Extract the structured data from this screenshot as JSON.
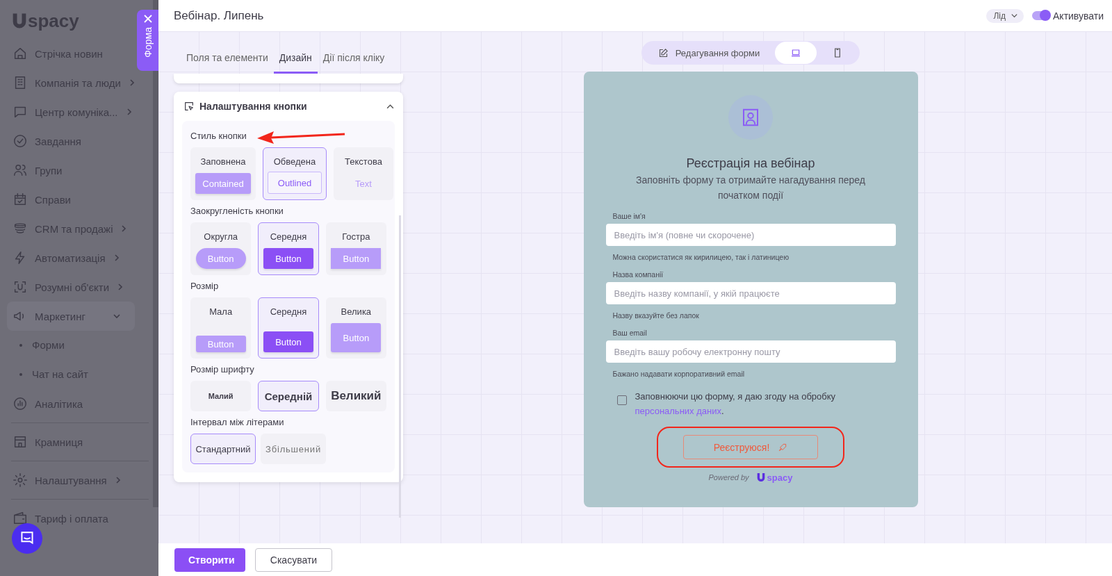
{
  "sidebar": {
    "logo": "spacy",
    "sections": [
      [
        {
          "label": "Стрічка новин"
        },
        {
          "label": "Компанія та люди",
          "expanded": false
        },
        {
          "label": "Центр комуніка...",
          "expanded": false
        },
        {
          "label": "Завдання"
        },
        {
          "label": "Групи"
        },
        {
          "label": "Справи"
        },
        {
          "label": "CRM та продажі",
          "expanded": false
        },
        {
          "label": "Автоматизація",
          "expanded": false
        },
        {
          "label": "Розумні об'єкти",
          "expanded": false
        },
        {
          "label": "Маркетинг",
          "expanded": true,
          "children": [
            {
              "label": "Форми"
            },
            {
              "label": "Чат на сайт"
            }
          ]
        },
        {
          "label": "Аналітика"
        }
      ],
      [
        {
          "label": "Крамниця"
        }
      ],
      [
        {
          "label": "Налаштування",
          "expanded": false
        }
      ],
      [
        {
          "label": "Тариф і оплата"
        }
      ]
    ]
  },
  "side_tab": {
    "label": "Форма"
  },
  "header": {
    "title": "Вебінар. Липень",
    "type_select": "Лід",
    "activate": {
      "label": "Активувати",
      "on": true
    }
  },
  "editor": {
    "tabs": [
      {
        "label": "Поля та елементи",
        "selected": false
      },
      {
        "label": "Дизайн",
        "selected": true
      },
      {
        "label": "Дії після кліку",
        "selected": false
      }
    ],
    "section": {
      "title": "Налаштування кнопки",
      "expanded": true,
      "groups": [
        {
          "label": "Стиль кнопки",
          "kind": "style",
          "options": [
            {
              "label": "Заповнена",
              "preview": "Contained",
              "kind": "contained",
              "selected": false
            },
            {
              "label": "Обведена",
              "preview": "Outlined",
              "kind": "outlined",
              "selected": true
            },
            {
              "label": "Текстова",
              "preview": "Text",
              "kind": "text",
              "selected": false
            }
          ]
        },
        {
          "label": "Заокругленість кнопки",
          "kind": "shape",
          "options": [
            {
              "label": "Округла",
              "preview": "Button",
              "kind": "round",
              "selected": false
            },
            {
              "label": "Середня",
              "preview": "Button",
              "kind": "medium",
              "selected": true
            },
            {
              "label": "Гостра",
              "preview": "Button",
              "kind": "sharp",
              "selected": false
            }
          ]
        },
        {
          "label": "Розмір",
          "kind": "size",
          "options": [
            {
              "label": "Мала",
              "preview": "Button",
              "kind": "small",
              "selected": false
            },
            {
              "label": "Середня",
              "preview": "Button",
              "kind": "medium",
              "selected": true
            },
            {
              "label": "Велика",
              "preview": "Button",
              "kind": "large",
              "selected": false
            }
          ]
        },
        {
          "label": "Розмір шрифту",
          "kind": "font",
          "options": [
            {
              "label": "Малий",
              "kind": "small",
              "selected": false
            },
            {
              "label": "Середній",
              "kind": "medium",
              "selected": true
            },
            {
              "label": "Великий",
              "kind": "large",
              "selected": false
            }
          ]
        },
        {
          "label": "Інтервал між літерами",
          "kind": "spacing",
          "options": [
            {
              "label": "Стандартний",
              "kind": "standard",
              "selected": true
            },
            {
              "label": "Збільшений",
              "kind": "wide",
              "selected": false
            }
          ]
        }
      ]
    }
  },
  "preview": {
    "modes": [
      {
        "label": "Редагування форми",
        "kind": "edit",
        "selected": false
      },
      {
        "kind": "desktop",
        "selected": true
      },
      {
        "kind": "mobile",
        "selected": false
      }
    ],
    "form": {
      "title": "Реєстрація на вебінар",
      "subtitle": "Заповніть форму та отримайте нагадування перед початком події",
      "fields": [
        {
          "label": "Ваше ім'я",
          "placeholder": "Введіть ім'я (повне чи скорочене)",
          "hint": "Можна скористатися як кирилицею, так і латиницею"
        },
        {
          "label": "Назва компанії",
          "placeholder": "Введіть назву компанії, у якій працюєте",
          "hint": "Назву вказуйте без лапок"
        },
        {
          "label": "Ваш email",
          "placeholder": "Введіть вашу робочу електронну пошту",
          "hint": "Бажано надавати корпоративний email"
        }
      ],
      "consent": {
        "text": "Заповнюючи цю форму, я даю згоду на обробку",
        "link": "персональних даних",
        "end": ".",
        "checked": false
      },
      "submit": "Реєструюся!",
      "powered_by": "Powered by",
      "logo": "spacy"
    }
  },
  "footer": {
    "buttons": [
      {
        "label": "Створити",
        "kind": "primary"
      },
      {
        "label": "Скасувати",
        "kind": "secondary"
      }
    ]
  }
}
